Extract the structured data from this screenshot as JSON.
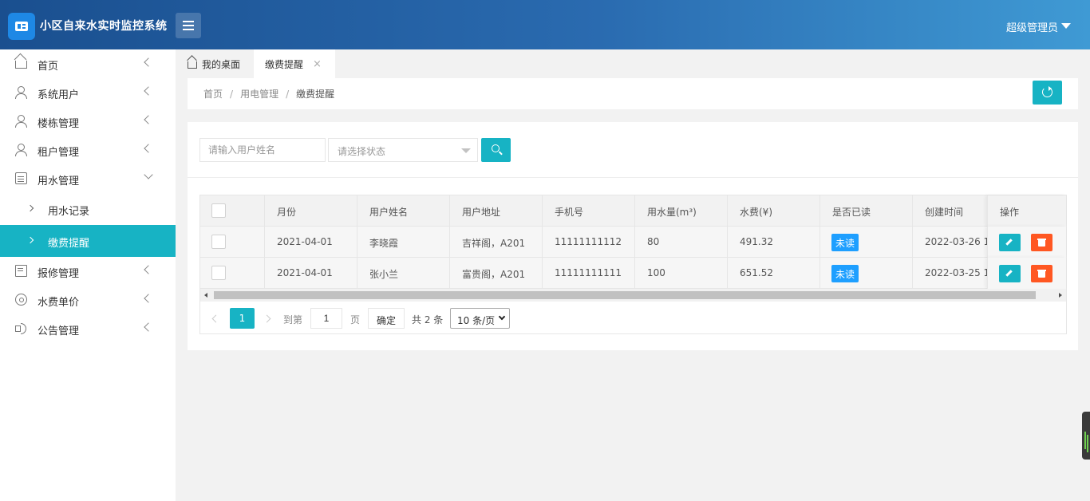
{
  "app": {
    "title": "小区自来水实时监控系统"
  },
  "header": {
    "user_name": "超级管理员"
  },
  "sidebar": {
    "items": [
      {
        "label": "首页",
        "icon": "home-icon"
      },
      {
        "label": "系统用户",
        "icon": "user-icon"
      },
      {
        "label": "楼栋管理",
        "icon": "user-icon"
      },
      {
        "label": "租户管理",
        "icon": "user-icon"
      },
      {
        "label": "用水管理",
        "icon": "calendar-icon"
      },
      {
        "label": "报修管理",
        "icon": "document-icon"
      },
      {
        "label": "水费单价",
        "icon": "gear-icon"
      },
      {
        "label": "公告管理",
        "icon": "speaker-icon"
      }
    ],
    "subitems": [
      {
        "label": "用水记录"
      },
      {
        "label": "缴费提醒"
      }
    ]
  },
  "tabs": [
    {
      "label": "我的桌面"
    },
    {
      "label": "缴费提醒"
    }
  ],
  "tab_close_glyph": "×",
  "breadcrumb": {
    "items": [
      "首页",
      "用电管理",
      "缴费提醒"
    ],
    "separator": "/"
  },
  "search": {
    "name_placeholder": "请输入用户姓名",
    "status_placeholder": "请选择状态"
  },
  "table": {
    "columns": [
      "月份",
      "用户姓名",
      "用户地址",
      "手机号",
      "用水量(m³)",
      "水费(¥)",
      "是否已读",
      "创建时间",
      "操作"
    ],
    "rows": [
      {
        "month": "2021-04-01",
        "name": "李晓霞",
        "address": "吉祥阁，A201",
        "phone": "11111111112",
        "usage": "80",
        "fee": "491.32",
        "read_status": "未读",
        "created": "2022-03-26 1..."
      },
      {
        "month": "2021-04-01",
        "name": "张小兰",
        "address": "富贵阁，A201",
        "phone": "11111111111",
        "usage": "100",
        "fee": "651.52",
        "read_status": "未读",
        "created": "2022-03-25 1..."
      }
    ]
  },
  "pagination": {
    "current_page": "1",
    "goto_label": "到第",
    "goto_value": "1",
    "page_label": "页",
    "confirm_label": "确定",
    "total_label": "共 2 条",
    "page_size": "10 条/页"
  },
  "colors": {
    "accent": "#17b3c4",
    "badge": "#1e9fff",
    "danger": "#ff5722",
    "header_start": "#1a4f8f",
    "header_end": "#3f9ad4"
  }
}
